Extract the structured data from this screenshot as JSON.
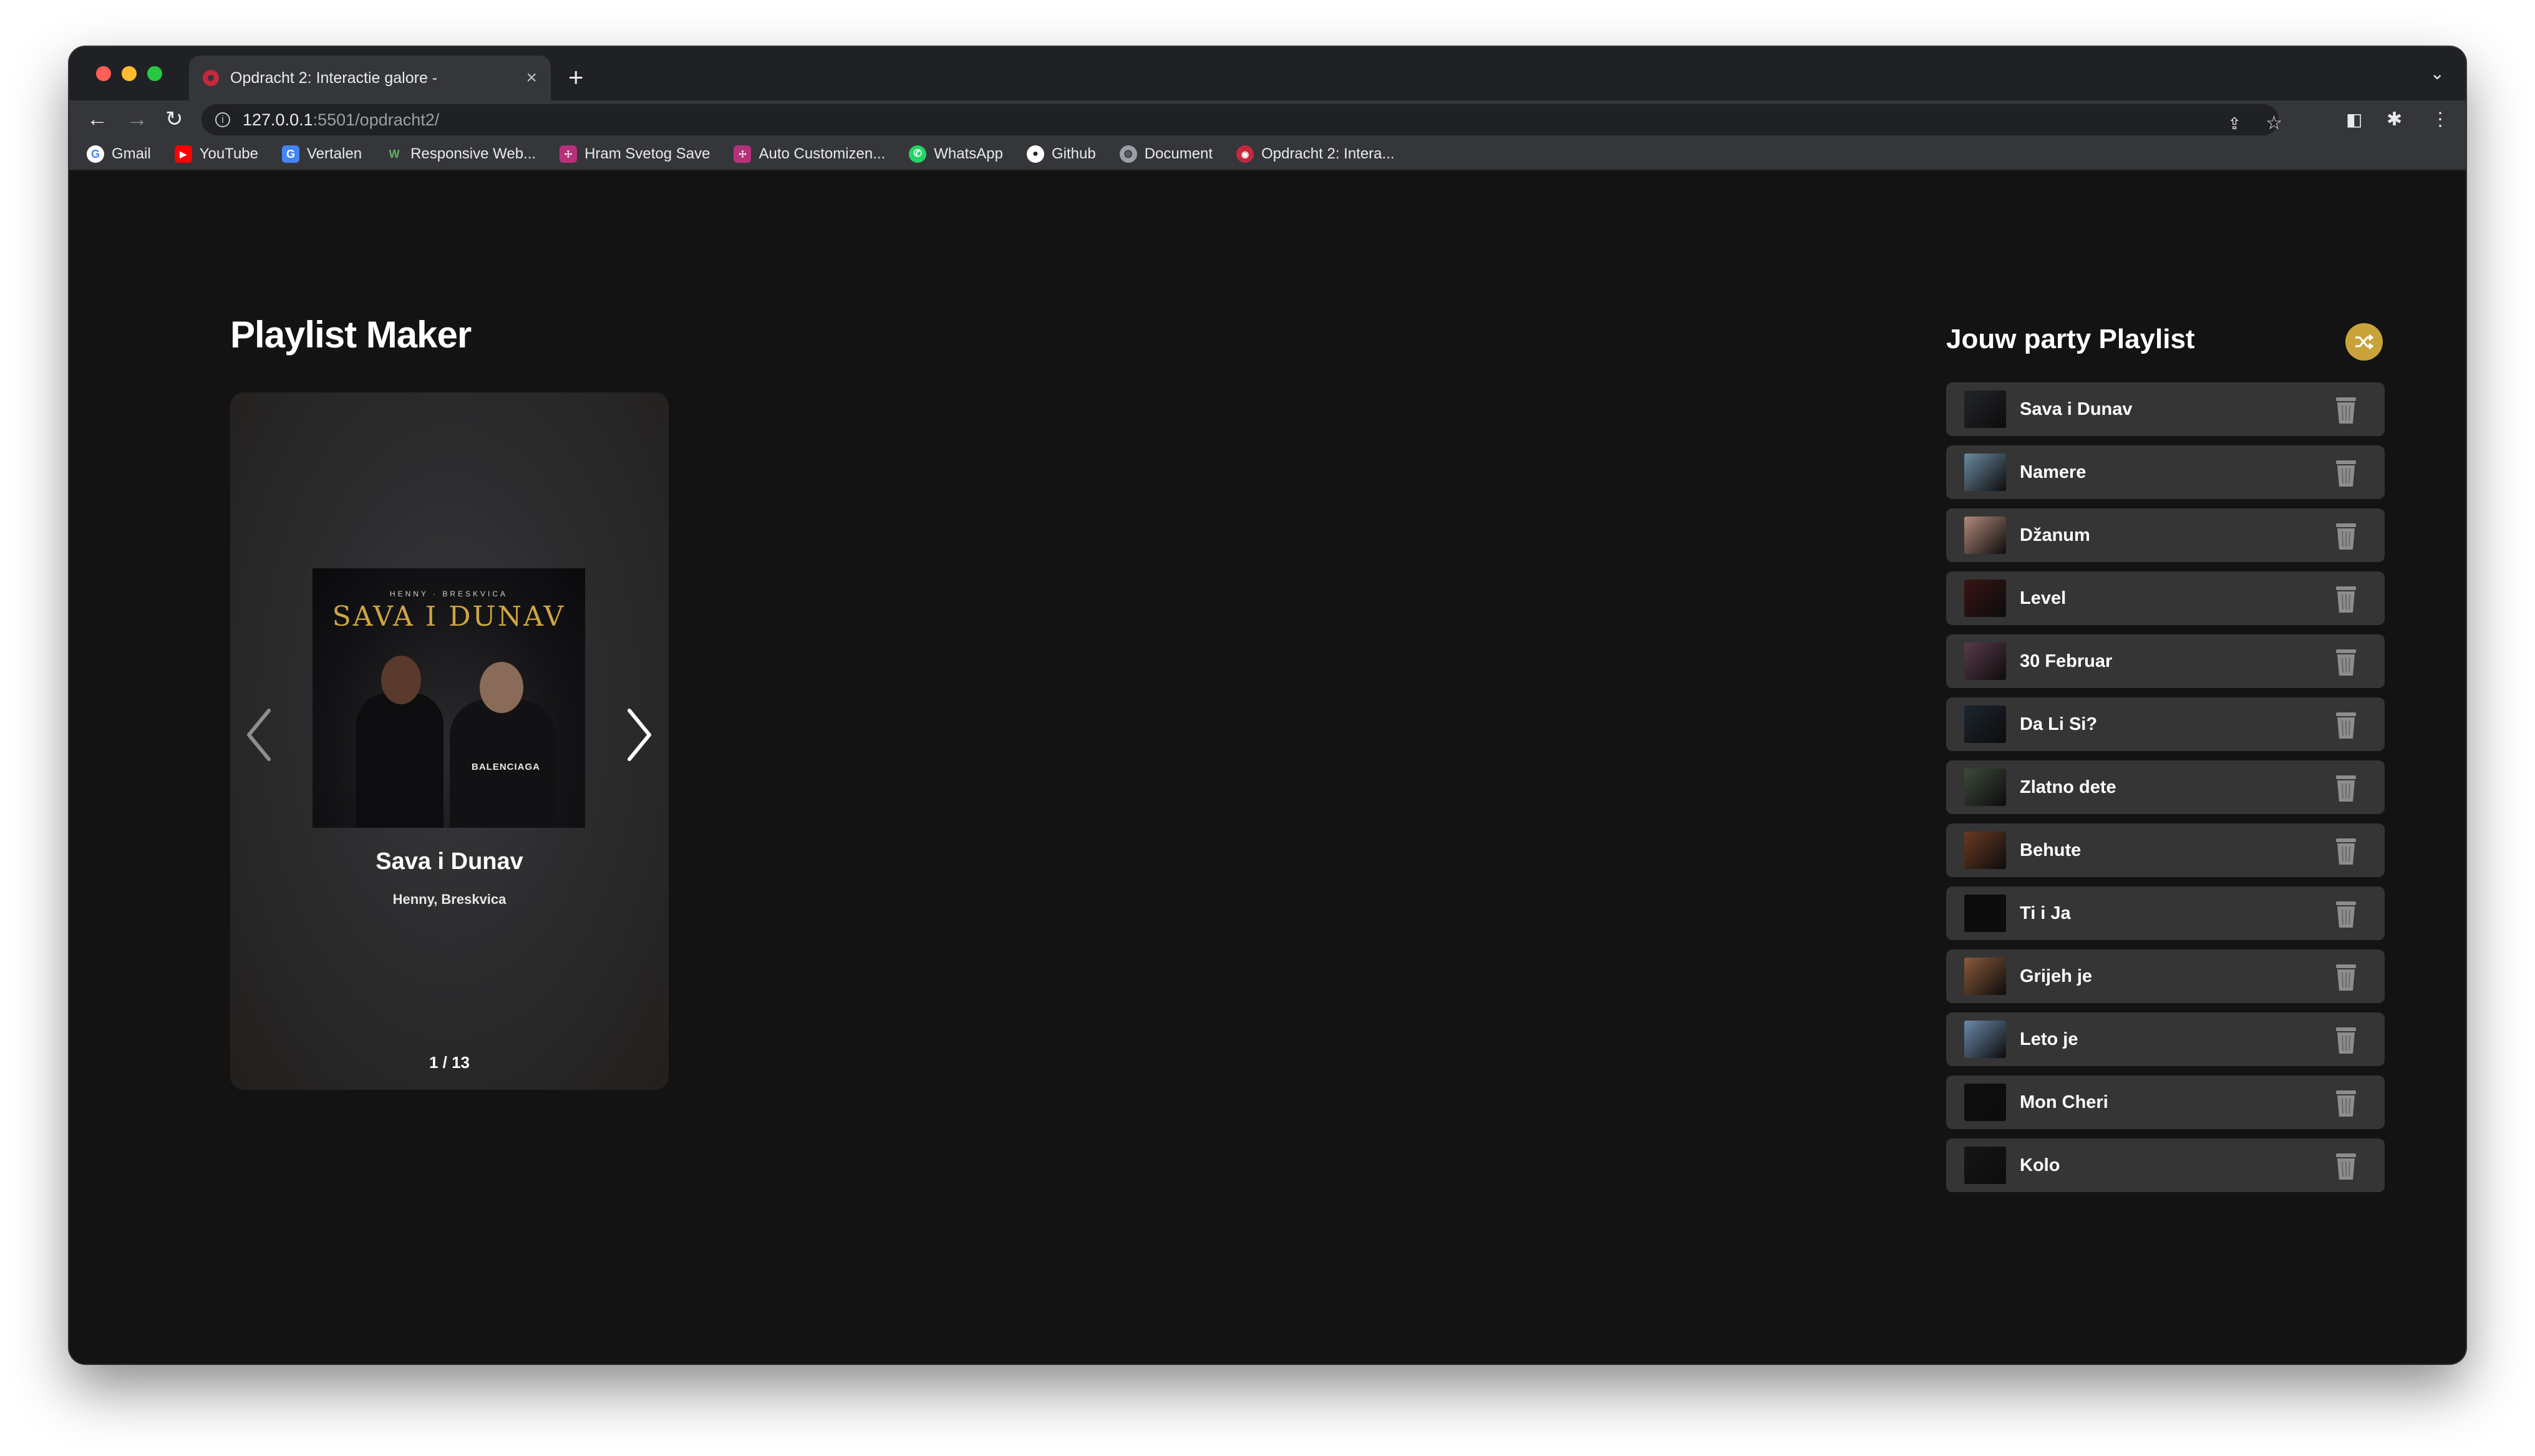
{
  "browser": {
    "tab_title": "Opdracht 2: Interactie galore -",
    "tab_close": "×",
    "new_tab": "+",
    "tab_menu": "⌄",
    "url_host": "127.0.0.1",
    "url_path": ":5501/opdracht2/",
    "bookmarks": [
      {
        "label": "Gmail",
        "icon": "gmail-icon",
        "color": "#ffffff"
      },
      {
        "label": "YouTube",
        "icon": "youtube-icon",
        "color": "#ff0000"
      },
      {
        "label": "Vertalen",
        "icon": "translate-icon",
        "color": "#4285f4"
      },
      {
        "label": "Responsive Web...",
        "icon": "webflow-icon",
        "color": "#35363a"
      },
      {
        "label": "Hram Svetog Save",
        "icon": "church-icon",
        "color": "#b5317a"
      },
      {
        "label": "Auto Customizen...",
        "icon": "car-icon",
        "color": "#b5317a"
      },
      {
        "label": "WhatsApp",
        "icon": "whatsapp-icon",
        "color": "#25d366"
      },
      {
        "label": "Github",
        "icon": "github-icon",
        "color": "#ffffff"
      },
      {
        "label": "Document",
        "icon": "globe-icon",
        "color": "#9aa0a6"
      },
      {
        "label": "Opdracht 2: Intera...",
        "icon": "page-icon",
        "color": "#c5283d"
      }
    ]
  },
  "page": {
    "title": "Playlist Maker"
  },
  "card": {
    "cover_artists": "HENNY · BRESKVICA",
    "cover_title": "SAVA I DUNAV",
    "cover_tag": "BALENCIAGA",
    "song": "Sava i Dunav",
    "artist": "Henny, Breskvica",
    "counter": "1 / 13"
  },
  "playlist": {
    "title": "Jouw party Playlist",
    "accent": "#c9a33a",
    "items": [
      {
        "name": "Sava i Dunav",
        "thumb": "#23252b"
      },
      {
        "name": "Namere",
        "thumb": "#6a8ba1"
      },
      {
        "name": "Džanum",
        "thumb": "#b08a7a"
      },
      {
        "name": "Level",
        "thumb": "#3a1414"
      },
      {
        "name": "30 Februar",
        "thumb": "#5a3a4a"
      },
      {
        "name": "Da Li Si?",
        "thumb": "#1c2630"
      },
      {
        "name": "Zlatno dete",
        "thumb": "#3d4a3a"
      },
      {
        "name": "Behute",
        "thumb": "#6a3a22"
      },
      {
        "name": "Ti i Ja",
        "thumb": "#0b0b0b"
      },
      {
        "name": "Grijeh je",
        "thumb": "#8a5a3a"
      },
      {
        "name": "Leto je",
        "thumb": "#6a8aaa"
      },
      {
        "name": "Mon Cheri",
        "thumb": "#0e0e0e"
      },
      {
        "name": "Kolo",
        "thumb": "#161616"
      }
    ]
  }
}
